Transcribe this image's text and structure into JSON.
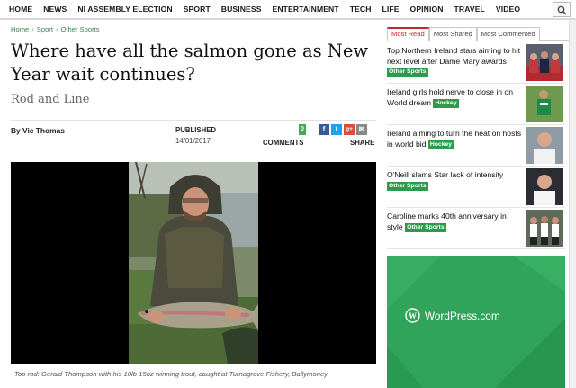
{
  "nav": {
    "items": [
      "HOME",
      "NEWS",
      "NI ASSEMBLY ELECTION",
      "SPORT",
      "BUSINESS",
      "ENTERTAINMENT",
      "TECH",
      "LIFE",
      "OPINION",
      "TRAVEL",
      "VIDEO"
    ],
    "search_icon": "search-icon"
  },
  "breadcrumb": [
    "Home",
    "Sport",
    "Other Sports"
  ],
  "article": {
    "headline": "Where have all the salmon gone as New Year wait continues?",
    "section": "Rod and Line",
    "byline": "By Vic Thomas",
    "published_label": "PUBLISHED",
    "published_date": "14/01/2017",
    "comments_count": "0",
    "comments_label": "COMMENTS",
    "share_label": "SHARE",
    "share_icons": [
      "facebook-icon",
      "twitter-icon",
      "google-plus-icon",
      "email-icon"
    ],
    "caption": "Top rod: Gerald Thompson with his 10lb 15oz winning trout, caught at Turnagrove Fishery, Ballymoney"
  },
  "sidebar": {
    "tabs": [
      "Most Read",
      "Most Shared",
      "Most Commented"
    ],
    "stories": [
      {
        "title": "Top Northern Ireland stars aiming to hit next level after Dame Mary awards",
        "tag": "Other Sports"
      },
      {
        "title": "Ireland girls hold nerve to close in on World dream",
        "tag": "Hockey"
      },
      {
        "title": "Ireland aiming to turn the heat on hosts in world bid",
        "tag": "Hockey"
      },
      {
        "title": "O'Neill slams Star lack of intensity",
        "tag": "Other Sports"
      },
      {
        "title": "Caroline marks 40th anniversary in style",
        "tag": "Other Sports"
      }
    ]
  },
  "ad": {
    "text": "WordPress.com"
  },
  "colors": {
    "accent_red": "#c1272d",
    "tag_green": "#2e9b4a",
    "ad_green": "#2fa45a",
    "breadcrumb_green": "#3b7f4c"
  }
}
